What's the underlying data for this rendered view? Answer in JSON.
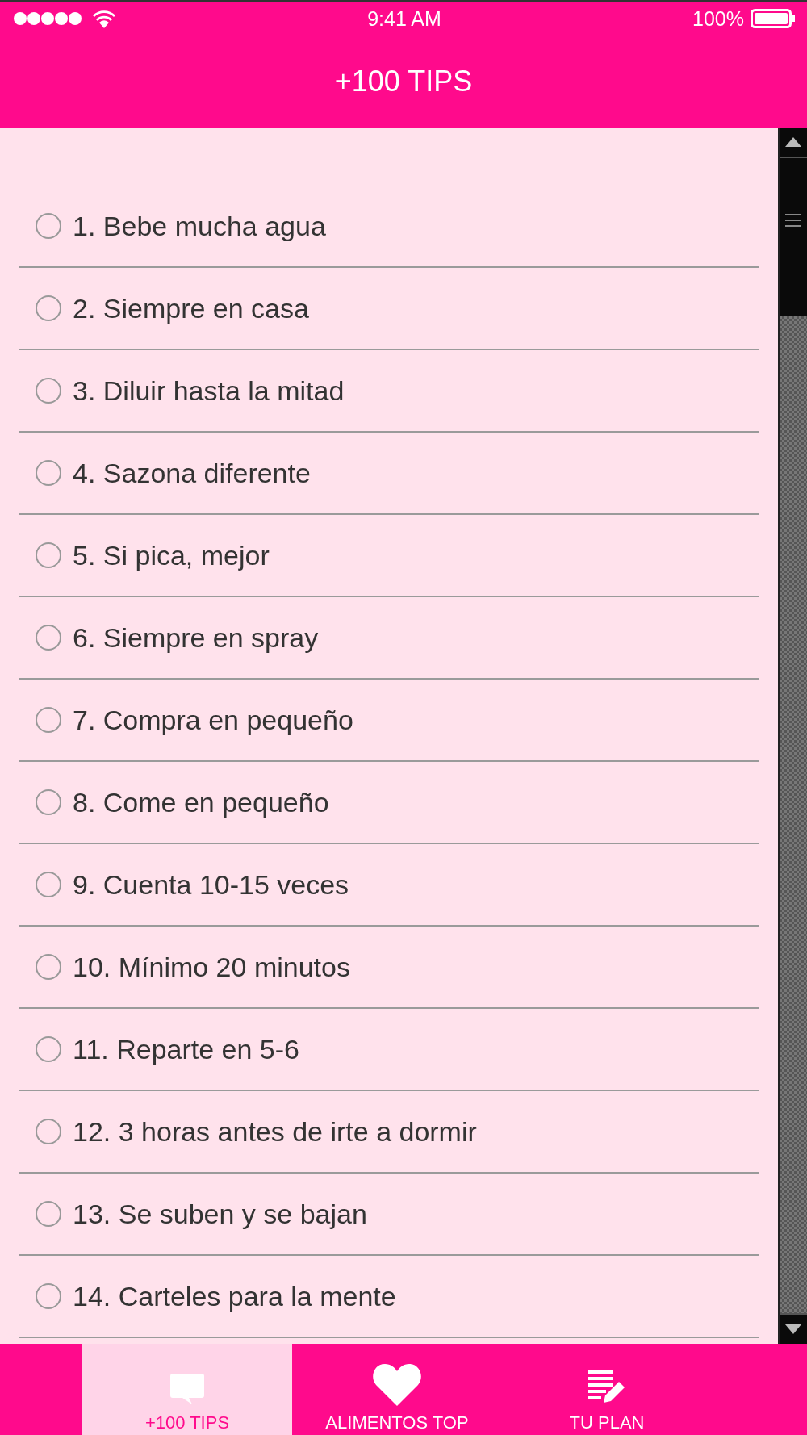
{
  "status_bar": {
    "time": "9:41 AM",
    "battery": "100%"
  },
  "header": {
    "title": "+100 TIPS"
  },
  "tips": [
    {
      "label": "1. Bebe mucha agua",
      "selected": false
    },
    {
      "label": "2. Siempre en casa",
      "selected": false
    },
    {
      "label": "3. Diluir hasta la mitad",
      "selected": false
    },
    {
      "label": "4. Sazona diferente",
      "selected": false
    },
    {
      "label": "5. Si pica, mejor",
      "selected": false
    },
    {
      "label": "6. Siempre en spray",
      "selected": false
    },
    {
      "label": "7. Compra en pequeño",
      "selected": false
    },
    {
      "label": "8. Come en pequeño",
      "selected": false
    },
    {
      "label": "9. Cuenta 10-15 veces",
      "selected": false
    },
    {
      "label": "10. Mínimo 20 minutos",
      "selected": false
    },
    {
      "label": "11. Reparte en 5-6",
      "selected": false
    },
    {
      "label": "12. 3 horas antes de irte a dormir",
      "selected": false
    },
    {
      "label": "13. Se suben y se bajan",
      "selected": false
    },
    {
      "label": "14. Carteles para la mente",
      "selected": false
    }
  ],
  "tab_bar": [
    {
      "label": "+100 TIPS",
      "kind": "chat",
      "selected": true
    },
    {
      "label": "ALIMENTOS TOP",
      "kind": "heart",
      "selected": false
    },
    {
      "label": "TU PLAN",
      "kind": "notes",
      "selected": false
    }
  ]
}
